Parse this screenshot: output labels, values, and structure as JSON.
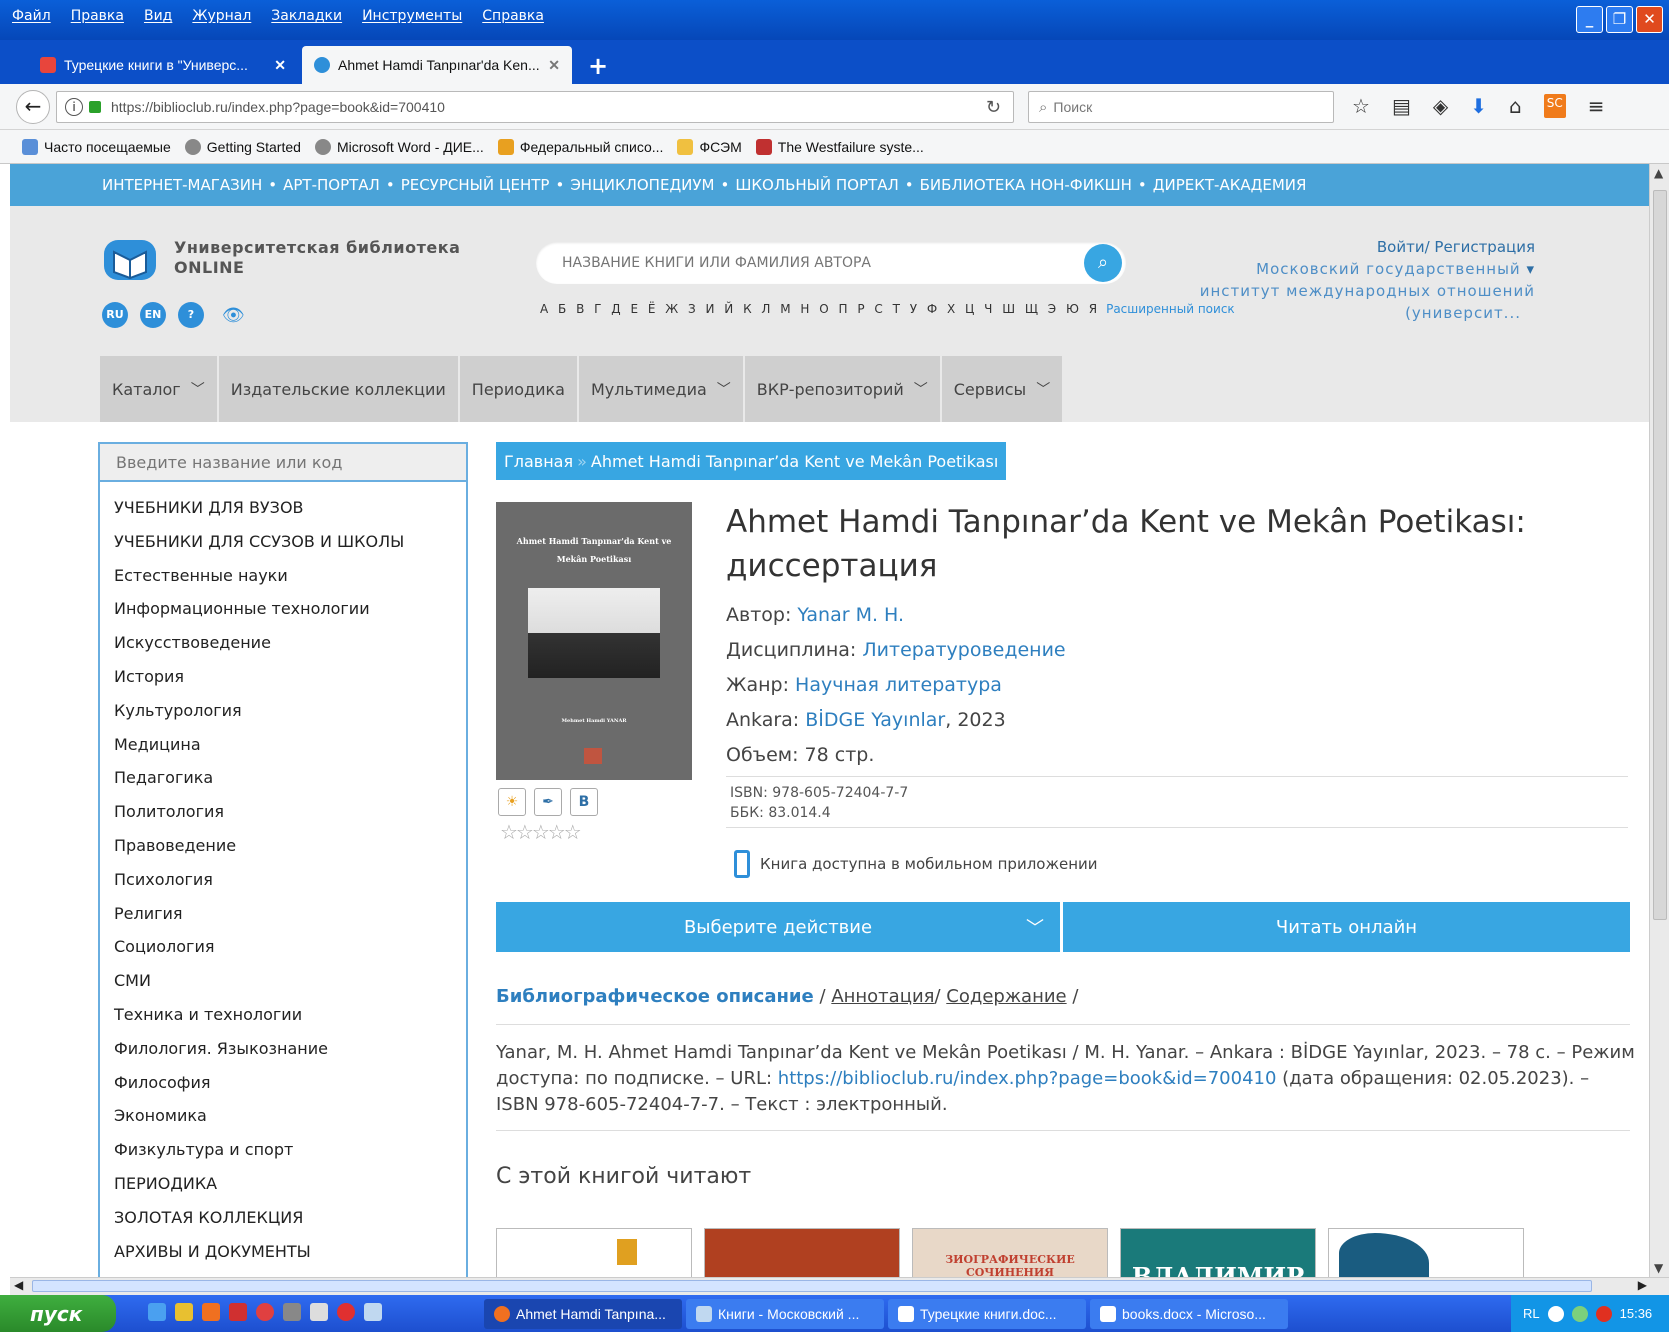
{
  "menubar": [
    "Файл",
    "Правка",
    "Вид",
    "Журнал",
    "Закладки",
    "Инструменты",
    "Справка"
  ],
  "tabs": [
    {
      "title": "Турецкие книги в \"Универс...",
      "close": "✕"
    },
    {
      "title": "Ahmet Hamdi Tanpınar'da Ken...",
      "close": "✕"
    }
  ],
  "newtab": "+",
  "urlbar": {
    "url": "https://biblioclub.ru/index.php?page=book&id=700410"
  },
  "searchbar": {
    "placeholder": "Поиск"
  },
  "bookmarks": [
    "Часто посещаемые",
    "Getting Started",
    "Microsoft Word - ДИЕ...",
    "Федеральный списо...",
    "ФСЭМ",
    "The Westfailure syste..."
  ],
  "site": {
    "topstrip": [
      "ИНТЕРНЕТ-МАГАЗИН",
      "АРТ-ПОРТАЛ",
      "РЕСУРСНЫЙ ЦЕНТР",
      "ЭНЦИКЛОПЕДИУМ",
      "ШКОЛЬНЫЙ ПОРТАЛ",
      "БИБЛИОТЕКА НОН-ФИКШН",
      "ДИРЕКТ-АКАДЕМИЯ"
    ],
    "logo_line1": "Университетская библиотека",
    "logo_line2": "ONLINE",
    "langs": [
      "RU",
      "EN",
      "?"
    ],
    "search_placeholder": "НАЗВАНИЕ КНИГИ ИЛИ ФАМИЛИЯ АВТОРА",
    "alphabet": "А Б В Г Д Е Ё Ж З И Й К Л М Н О П Р С Т У Ф Х Ц Ч Ш Щ Э Ю Я",
    "advanced_search": "Расширенный поиск",
    "login": "Войти/ Регистрация",
    "org_line1": "Московский государственный",
    "org_line2": "институт международных отношений",
    "org_line3": "(университ..."
  },
  "mainnav": [
    {
      "label": "Каталог",
      "dropdown": true
    },
    {
      "label": "Издательские коллекции",
      "dropdown": false
    },
    {
      "label": "Периодика",
      "dropdown": false
    },
    {
      "label": "Мультимедиа",
      "dropdown": true
    },
    {
      "label": "ВКР-репозиторий",
      "dropdown": true
    },
    {
      "label": "Сервисы",
      "dropdown": true
    }
  ],
  "sidebar": {
    "search_placeholder": "Введите название или код",
    "items": [
      "УЧЕБНИКИ ДЛЯ ВУЗОВ",
      "УЧЕБНИКИ ДЛЯ ССУЗОВ И ШКОЛЫ",
      "Естественные науки",
      "Информационные технологии",
      "Искусствоведение",
      "История",
      "Культурология",
      "Медицина",
      "Педагогика",
      "Политология",
      "Правоведение",
      "Психология",
      "Религия",
      "Социология",
      "СМИ",
      "Техника и технологии",
      "Филология. Языкознание",
      "Философия",
      "Экономика",
      "Физкультура и спорт",
      "ПЕРИОДИКА",
      "ЗОЛОТАЯ КОЛЛЕКЦИЯ",
      "АРХИВЫ И ДОКУМЕНТЫ"
    ]
  },
  "breadcrumb": {
    "home": "Главная",
    "sep": "»",
    "current": "Ahmet Hamdi Tanpınar’da Kent ve Mekân Poetikası"
  },
  "book": {
    "cover_title_1": "Ahmet Hamdi Tanpınar'da Kent ve",
    "cover_title_2": "Mekân Poetikası",
    "cover_author": "Mehmet Hamdi YANAR",
    "title": "Ahmet Hamdi Tanpınar’da Kent ve Mekân Poetikası: диссертация",
    "author_label": "Автор:",
    "author": "Yanar M. H.",
    "discipline_label": "Дисциплина:",
    "discipline": "Литературоведение",
    "genre_label": "Жанр:",
    "genre": "Научная литература",
    "city": "Ankara:",
    "publisher": "BİDGE Yayınlar",
    "year": ", 2023",
    "volume": "Объем: 78 стр.",
    "isbn": "ISBN: 978-605-72404-7-7",
    "bbk": "ББК: 83.014.4",
    "mobile_note": "Книга доступна в мобильном приложении",
    "rating": "☆☆☆☆☆"
  },
  "share": [
    "☀",
    "✒",
    "B"
  ],
  "actions": {
    "select": "Выберите действие",
    "read": "Читать онлайн"
  },
  "desc_tabs": {
    "biblio": "Библиографическое описание",
    "sep1": "/",
    "annotation": "Аннотация",
    "sep2": "/",
    "contents": "Содержание",
    "sep3": "/"
  },
  "biblio": {
    "part1": "Yanar, M. H. Ahmet Hamdi Tanpınar’da Kent ve Mekân Poetikası / M. H. Yanar. – Ankara : BİDGE Yayınlar, 2023. – 78 с. – Режим доступа: по подписке. – URL: ",
    "url": "https://biblioclub.ru/index.php?page=book&id=700410",
    "part2": " (дата обращения: 02.05.2023). – ISBN 978-605-72404-7-7. – Текст : электронный."
  },
  "also_read": "С этой книгой читают",
  "also_thumbs": [
    "",
    "",
    "ЗИОГРАФИЧЕСКИЕ СОЧИНЕНИЯ",
    "ВЛАДИМИР",
    ""
  ],
  "taskbar": {
    "start": "пуск",
    "tasks": [
      "Ahmet Hamdi Tanpına...",
      "Книги - Московский ...",
      "Турецкие книги.doc...",
      "books.docx - Microso..."
    ],
    "lang": "RL",
    "clock": "15:36"
  },
  "colors": {
    "accent": "#38a6e2",
    "link": "#2e7fbf",
    "nav_bg": "#cfcfcf"
  }
}
